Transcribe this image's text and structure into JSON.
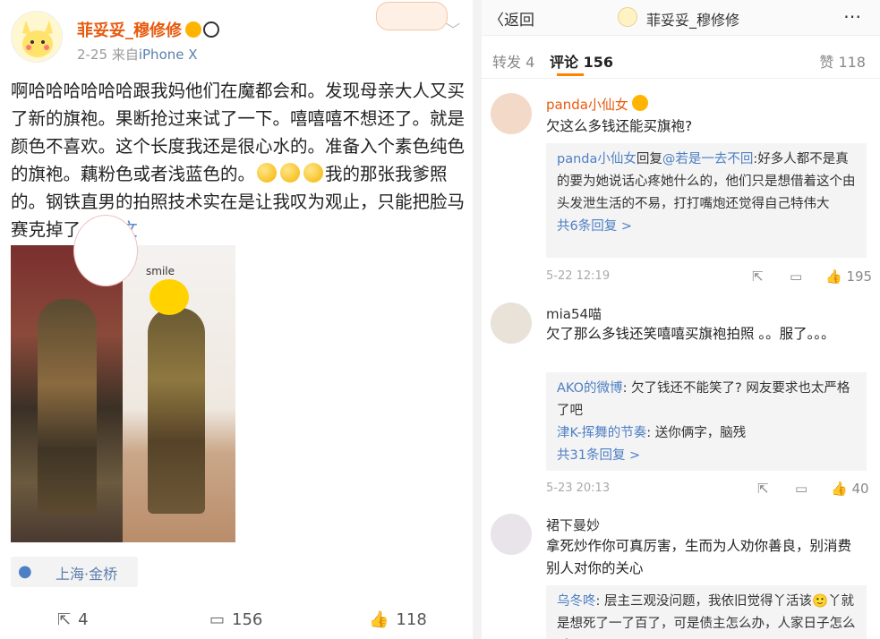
{
  "post": {
    "author": "菲妥妥_穆修修",
    "date": "2-25",
    "from_prefix": "来自",
    "device": "iPhone X",
    "text": "啊哈哈哈哈哈哈跟我妈他们在魔都会和。发现母亲大人又买了新的旗袍。果断抢过来试了一下。嘻嘻嘻不想还了。就是颜色不喜欢。这个长度我还是很心水的。准备入个素色纯色的旗袍。藕粉色或者浅蓝色的。",
    "text2": "我的那张我爹照的。钢铁直男的拍照技术实在是让我叹为观止，只能把脸马赛克掉了 ...",
    "more": "全文",
    "photo_sticker": "smile",
    "location": "上海·金桥",
    "actions": {
      "repost": "4",
      "comment": "156",
      "like": "118"
    }
  },
  "detail": {
    "back": "返回",
    "title": "菲妥妥_穆修修",
    "more_icon": "⋯",
    "tabs": {
      "repost": "转发 4",
      "comment": "评论 156",
      "like": "赞 118"
    },
    "comments": [
      {
        "name": "panda小仙女",
        "text": "欠这么多钱还能买旗袍?",
        "replies": [
          {
            "user": "panda小仙女",
            "mid": "回复",
            "to": "@若是一去不回",
            "text": ":好多人都不是真的要为她说话心疼她什么的，他们只是想借着这个由头发泄生活的不易，打打嘴炮还觉得自己特伟大"
          }
        ],
        "more_replies": "共6条回复 >",
        "time": "5-22 12:19",
        "likes": "195"
      },
      {
        "name": "mia54喵",
        "text": "欠了那么多钱还笑嘻嘻买旗袍拍照 。。服了。。。",
        "replies": [
          {
            "user": "AKO的微博",
            "text": ": 欠了钱还不能笑了? 网友要求也太严格了吧"
          },
          {
            "user": "津K-挥舞的节奏",
            "text": ": 送你俩字，脑残"
          }
        ],
        "more_replies": "共31条回复 >",
        "time": "5-23 20:13",
        "likes": "40"
      },
      {
        "name": "裙下曼妙",
        "text": "拿死炒作你可真厉害，生而为人劝你善良，别消费别人对你的关心",
        "replies": [
          {
            "user": "乌冬咚",
            "text": ": 层主三观没问题，我依旧觉得丫活该🙂丫就是想死了一了百了，可是债主怎么办，人家日子怎么过"
          }
        ]
      }
    ]
  },
  "colors": {
    "accent": "#ff8200",
    "link": "#4d7fc4",
    "author": "#e8590c"
  }
}
